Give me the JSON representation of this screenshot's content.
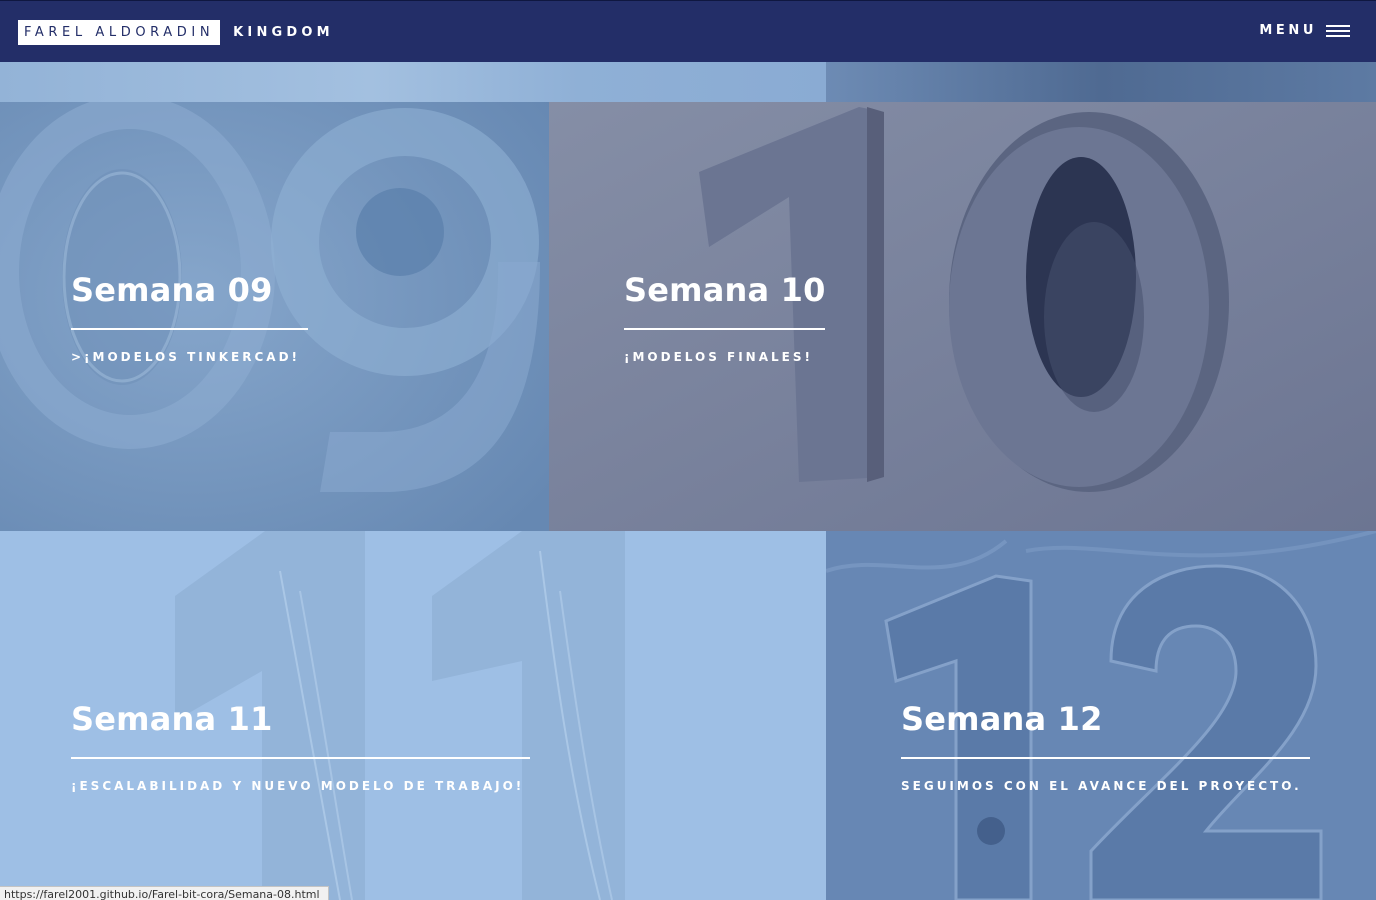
{
  "header": {
    "brand_box": "FAREL ALDORADIN",
    "brand_rest": "KINGDOM",
    "menu_label": "MENU"
  },
  "tiles": [
    {
      "title": "Semana 09",
      "subtitle": ">¡MODELOS TINKERCAD!",
      "background_icon": "number-09-image"
    },
    {
      "title": "Semana 10",
      "subtitle": "¡MODELOS FINALES!",
      "background_icon": "number-10-image"
    },
    {
      "title": "Semana 11",
      "subtitle": "¡ESCALABILIDAD Y NUEVO MODELO DE TRABAJO!",
      "background_icon": "number-11-image"
    },
    {
      "title": "Semana 12",
      "subtitle": "SEGUIMOS CON EL AVANCE DEL PROYECTO.",
      "background_icon": "number-12-image"
    }
  ],
  "status_bar": {
    "url": "https://farel2001.github.io/Farel-bit-cora/Semana-08.html"
  },
  "colors": {
    "header_bg": "#232e68",
    "tile_09": "#7394bb",
    "tile_10": "#7b88a0",
    "tile_11": "#9ebfe5",
    "tile_12": "#6787b4",
    "text": "#ffffff"
  }
}
